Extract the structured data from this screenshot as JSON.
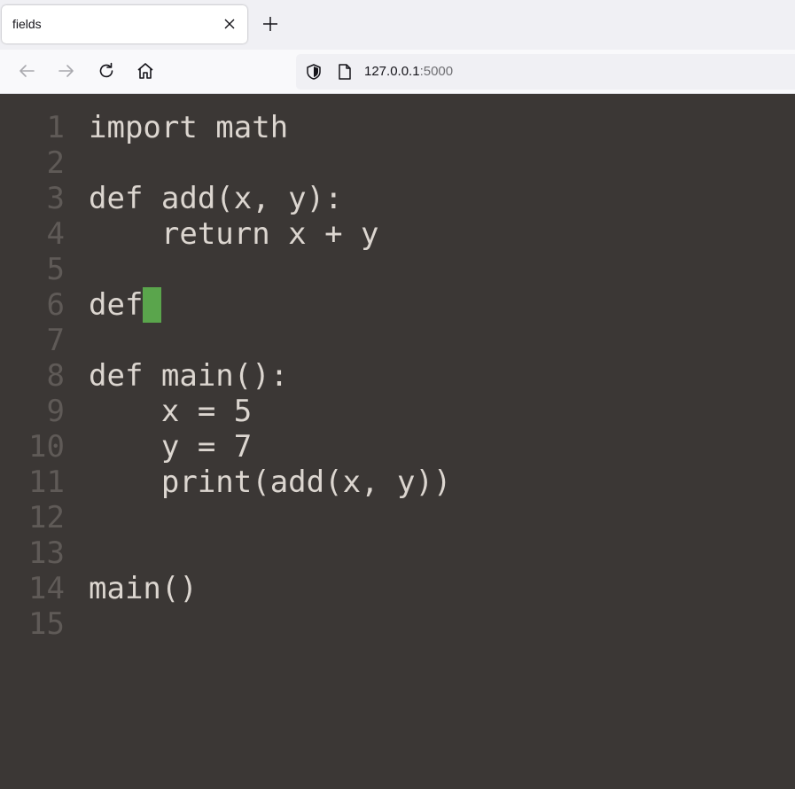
{
  "browser": {
    "tab_title": "fields",
    "url_host": "127.0.0.1",
    "url_port": ":5000"
  },
  "editor": {
    "lines": [
      {
        "num": "1",
        "text": "import math"
      },
      {
        "num": "2",
        "text": ""
      },
      {
        "num": "3",
        "text": "def add(x, y):"
      },
      {
        "num": "4",
        "text": "    return x + y"
      },
      {
        "num": "5",
        "text": ""
      },
      {
        "num": "6",
        "text": "def"
      },
      {
        "num": "7",
        "text": ""
      },
      {
        "num": "8",
        "text": "def main():"
      },
      {
        "num": "9",
        "text": "    x = 5"
      },
      {
        "num": "10",
        "text": "    y = 7"
      },
      {
        "num": "11",
        "text": "    print(add(x, y))"
      },
      {
        "num": "12",
        "text": ""
      },
      {
        "num": "13",
        "text": ""
      },
      {
        "num": "14",
        "text": "main()"
      },
      {
        "num": "15",
        "text": ""
      }
    ],
    "cursor_color": "#5aa54c"
  },
  "icons": {
    "tab_close": "close-icon",
    "new_tab": "plus-icon",
    "back": "arrow-left-icon",
    "forward": "arrow-right-icon",
    "reload": "reload-icon",
    "home": "home-icon",
    "shield": "shield-icon",
    "page": "page-icon"
  }
}
